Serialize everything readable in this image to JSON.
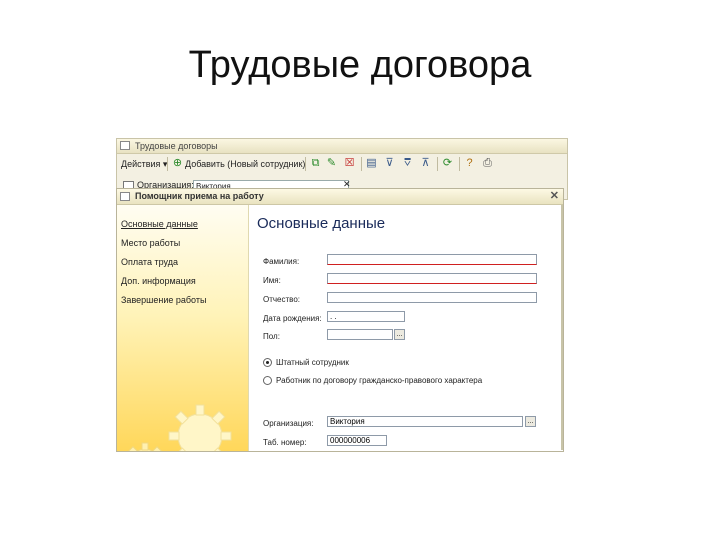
{
  "slide": {
    "title": "Трудовые договора"
  },
  "back_window": {
    "title": "Трудовые договоры",
    "toolbar": {
      "actions_label": "Действия ▾",
      "add_label": "Добавить (Новый сотрудник)"
    },
    "filter": {
      "org_label": "Организация:",
      "org_value": "Виктория"
    }
  },
  "wizard": {
    "title": "Помощник приема на работу",
    "nav": [
      {
        "label": "Основные данные"
      },
      {
        "label": "Место работы"
      },
      {
        "label": "Оплата труда"
      },
      {
        "label": "Доп. информация"
      },
      {
        "label": "Завершение работы"
      }
    ],
    "section_title": "Основные данные",
    "fields": {
      "surname_label": "Фамилия:",
      "name_label": "Имя:",
      "patronymic_label": "Отчество:",
      "birthdate_label": "Дата рождения:",
      "birthdate_value": " .  .",
      "gender_label": "Пол:",
      "org_label": "Организация:",
      "org_value": "Виктория",
      "tabnum_label": "Таб. номер:",
      "tabnum_value": "000000006"
    },
    "radios": {
      "staff_label": "Штатный сотрудник",
      "contract_label": "Работник по договору гражданско-правового характера"
    }
  },
  "colors": {
    "sidebar_gradient_top": "#fffdf2",
    "sidebar_gradient_bottom": "#ffd75a",
    "title_blue": "#1a2b5a",
    "required_red": "#d02020"
  },
  "icons": [
    "window-icon",
    "add-icon",
    "copy-icon",
    "edit-icon",
    "delete-icon",
    "tree-icon",
    "filter-icon",
    "filter-off-icon",
    "refresh-icon",
    "help-icon",
    "print-icon",
    "close-icon",
    "select-icon",
    "gear-icon"
  ]
}
